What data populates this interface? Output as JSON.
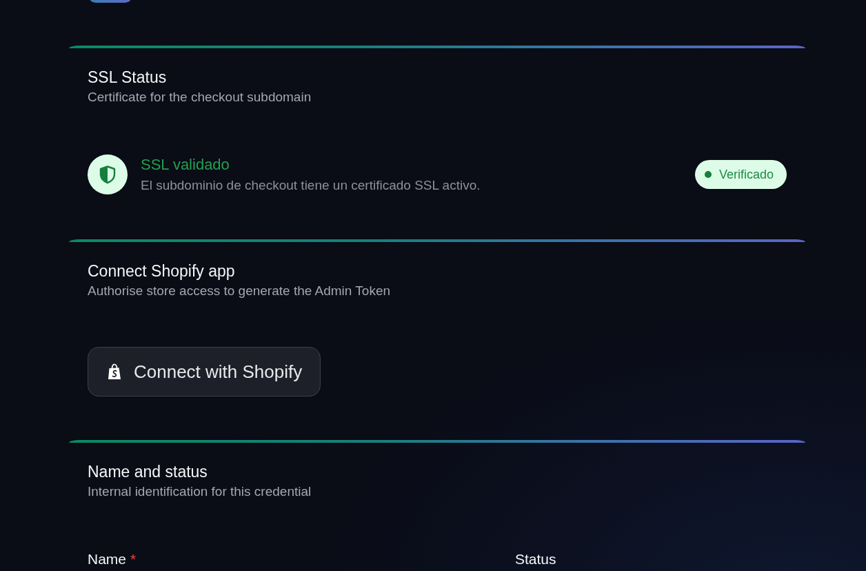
{
  "sections": [
    {
      "kind": "status",
      "title": "SSL Status",
      "subtitle": "Certificate for the checkout subdomain",
      "status": {
        "verified": true,
        "title": "SSL validado",
        "description": "El subdominio de checkout tiene un certificado SSL activo.",
        "badge": "Verificado"
      }
    },
    {
      "kind": "action",
      "title": "Connect Shopify app",
      "subtitle": "Authorise store access to generate the Admin Token",
      "button": {
        "label": "Connect with Shopify"
      }
    },
    {
      "kind": "form",
      "title": "Name and status",
      "subtitle": "Internal identification for this credential",
      "fields": [
        {
          "label": "Name",
          "required_mark": "*"
        },
        {
          "label": "Status"
        }
      ]
    }
  ]
}
